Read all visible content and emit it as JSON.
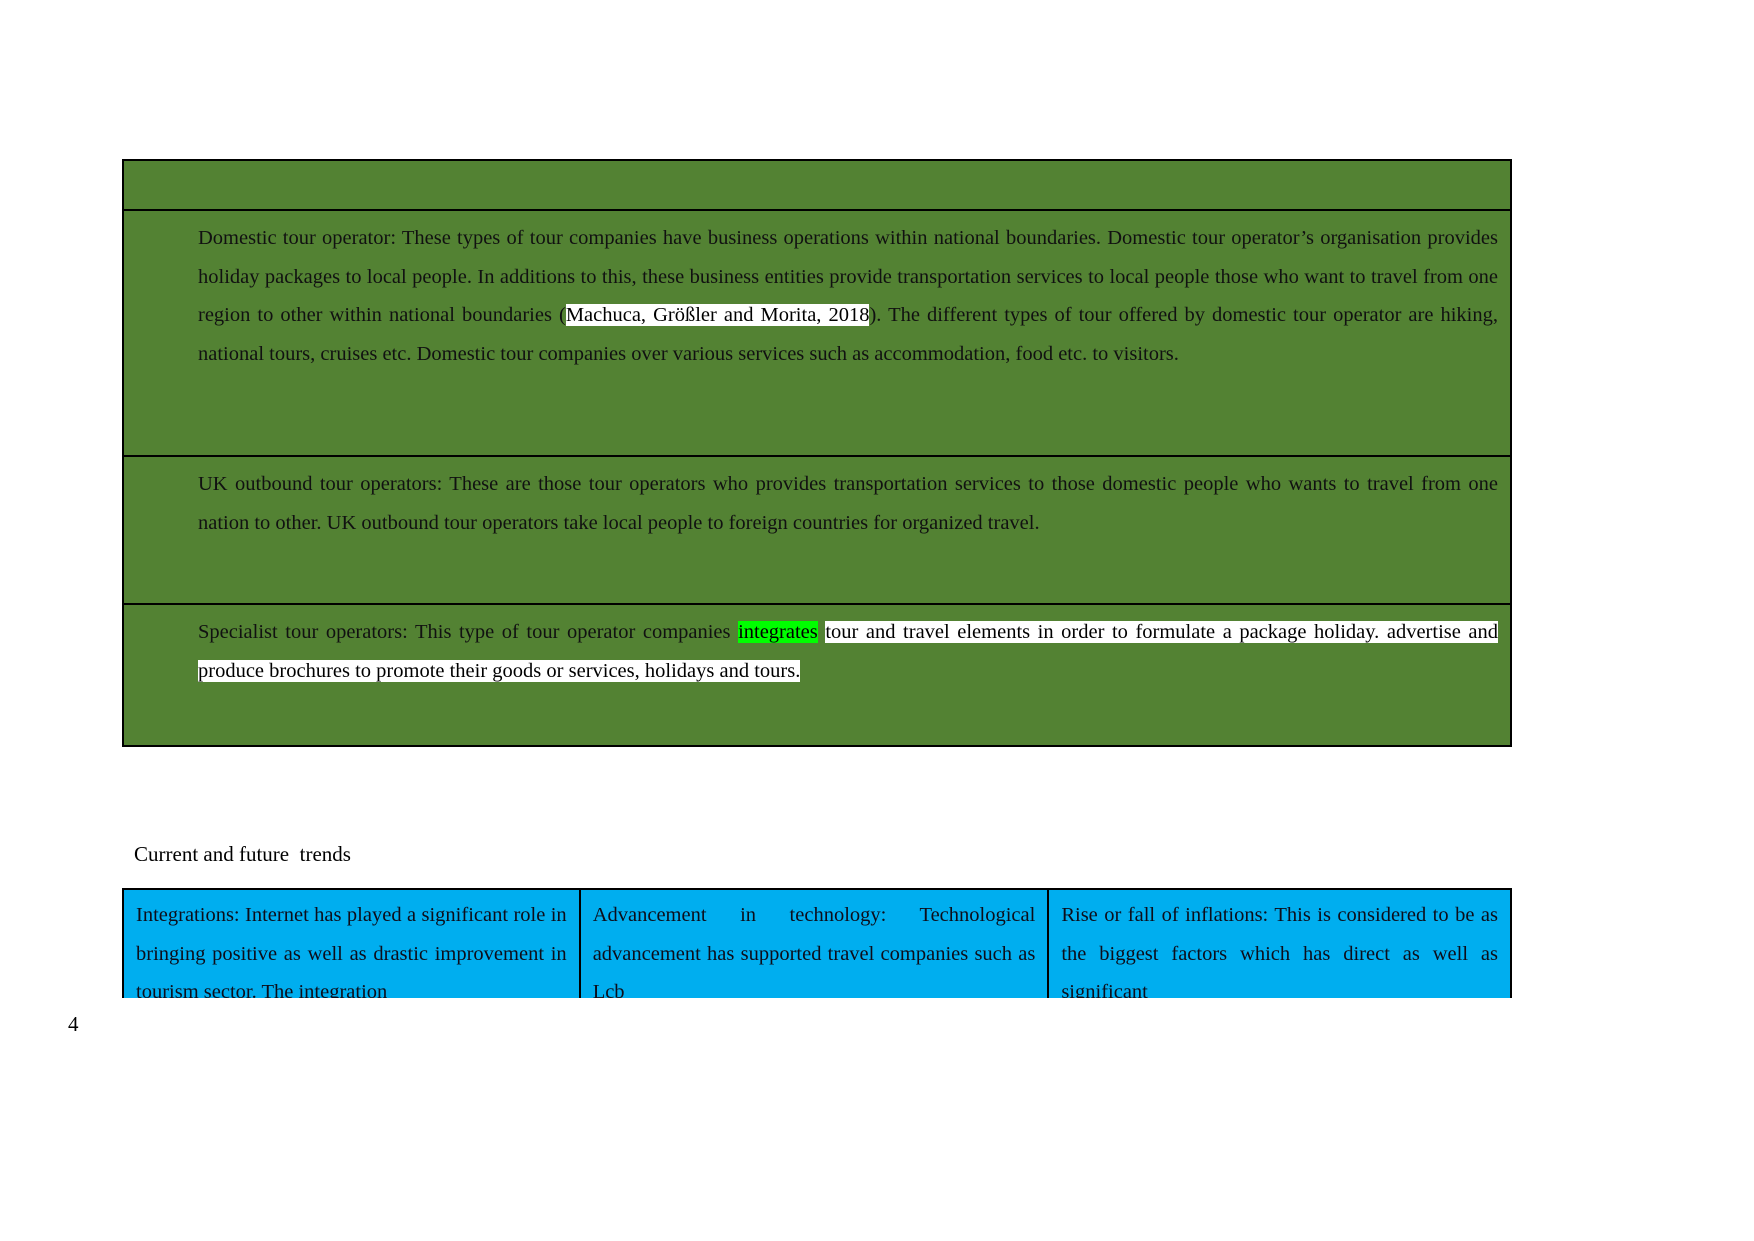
{
  "document": {
    "page_number": "4",
    "section_heading": "Current and future  trends"
  },
  "green_table": {
    "background_color": "#538233",
    "border_color": "#000000",
    "header_row_text": "",
    "rows": [
      {
        "name": "domestic-tour-operator",
        "segments": [
          {
            "text": "Domestic tour operator: These types of tour companies have business operations within national boundaries. Domestic tour operator’s organisation provides holiday packages to local people. In additions to this, these business entities provide transportation services to local people those who want to travel from one region to other within national boundaries (",
            "highlight": "none"
          },
          {
            "text": "Machuca,  Größler and Morita, 2018",
            "highlight": "white"
          },
          {
            "text": "). The different types of tour offered by domestic tour operator are hiking, national tours, cruises etc. Domestic tour companies over various services such as accommodation, food etc. to visitors.",
            "highlight": "none"
          }
        ]
      },
      {
        "name": "uk-outbound-tour-operators",
        "segments": [
          {
            "text": "UK outbound tour operators: These are those tour operators who provides transportation services to those domestic people who wants to travel from one nation to other. UK outbound tour operators take local people to foreign countries for organized travel.",
            "highlight": "none"
          }
        ]
      },
      {
        "name": "specialist-tour-operators",
        "segments": [
          {
            "text": "Specialist tour operators: This type of tour operator companies ",
            "highlight": "none"
          },
          {
            "text": "integrates",
            "highlight": "green"
          },
          {
            "text": " ",
            "highlight": "none"
          },
          {
            "text": "tour and travel elements in order to formulate a package holiday. advertise and produce brochures to promote their goods or services, holidays and tours.",
            "highlight": "white"
          }
        ]
      }
    ]
  },
  "blue_table": {
    "background_color": "#00AEEF",
    "border_color": "#000000",
    "columns": [
      {
        "name": "integrations",
        "text": "Integrations: Internet has played a significant role in bringing positive as well as drastic improvement in tourism sector. The integration"
      },
      {
        "name": "advancement-in-technology",
        "text": "Advancement in technology: Technological advancement has supported travel companies such as Lcb"
      },
      {
        "name": "rise-or-fall-of-inflations",
        "text": "Rise or fall of inflations: This is considered to be as the biggest factors which has direct as well as significant"
      }
    ]
  }
}
